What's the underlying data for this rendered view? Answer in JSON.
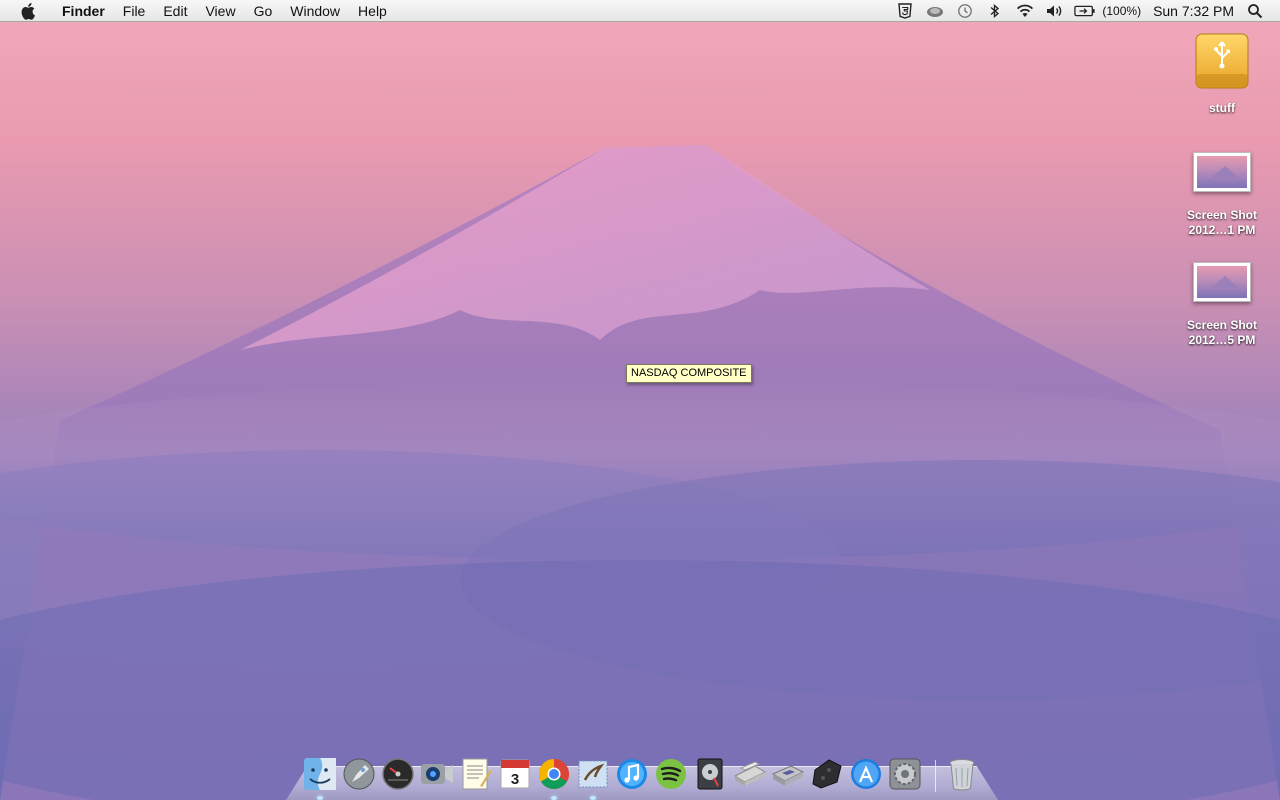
{
  "menubar": {
    "app_name": "Finder",
    "menus": [
      "File",
      "Edit",
      "View",
      "Go",
      "Window",
      "Help"
    ],
    "battery_percent": "(100%)",
    "clock": "Sun 7:32 PM",
    "tray_icons": [
      "html5-icon",
      "cloud-app-icon",
      "time-machine-icon",
      "bluetooth-icon",
      "wifi-icon",
      "volume-icon",
      "battery-icon"
    ]
  },
  "desktop": {
    "icons": [
      {
        "label": "stuff",
        "icon": "usb-drive-icon"
      },
      {
        "label_line1": "Screen Shot",
        "label_line2": "2012…1 PM",
        "icon": "screenshot-thumbnail-icon"
      },
      {
        "label_line1": "Screen Shot",
        "label_line2": "2012…5 PM",
        "icon": "screenshot-thumbnail-icon"
      }
    ]
  },
  "tooltip": {
    "text": "NASDAQ COMPOSITE"
  },
  "dock": {
    "items": [
      "finder-icon",
      "launchpad-icon",
      "dashboard-icon",
      "facetime-icon",
      "textedit-icon",
      "calendar-icon",
      "chrome-icon",
      "mail-icon",
      "itunes-icon",
      "spotify-icon",
      "disk-utility-icon",
      "scanner-icon",
      "snes-emulator-icon",
      "game-controller-icon",
      "app-store-icon",
      "system-preferences-icon",
      "trash-icon"
    ],
    "calendar_day": "3",
    "accent": "#3aa8ff"
  }
}
